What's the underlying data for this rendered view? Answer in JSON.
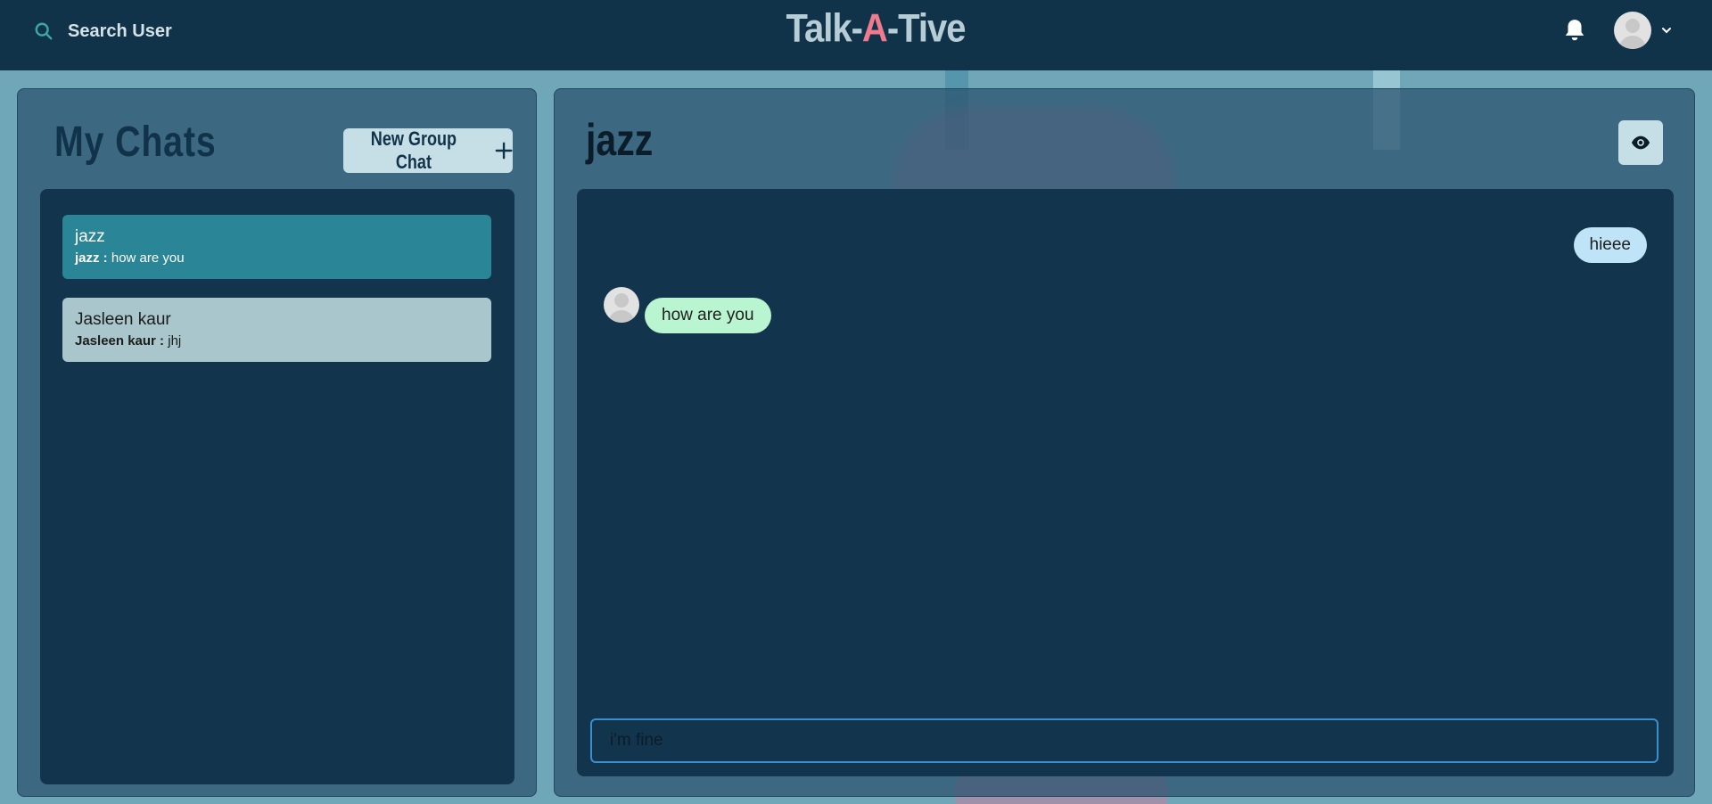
{
  "header": {
    "search_label": "Search User",
    "logo_prefix": "Talk-",
    "logo_accent": "A",
    "logo_suffix": "-Tive",
    "icons": {
      "search": "search-icon",
      "bell": "bell-icon",
      "avatar": "avatar-icon",
      "chevron": "chevron-down-icon"
    }
  },
  "sidebar": {
    "title": "My Chats",
    "new_group_label": "New Group Chat",
    "chats": [
      {
        "name": "jazz",
        "last_sender": "jazz :",
        "last_message": " how are you",
        "active": true
      },
      {
        "name": "Jasleen kaur",
        "last_sender": "Jasleen kaur :",
        "last_message": " jhj",
        "active": false
      }
    ]
  },
  "conversation": {
    "title": "jazz",
    "messages": [
      {
        "text": "hieee",
        "mine": true
      },
      {
        "text": "how are you",
        "mine": false
      }
    ],
    "input_value": "i'm fine"
  },
  "colors": {
    "header_bg": "#11334a",
    "accent": "#f07a8e",
    "active_chat": "#2a8596",
    "inactive_chat": "#a8c6cb",
    "my_bubble": "#bfe3f7",
    "their_bubble": "#b9f5d0",
    "input_border": "#3a8fd0"
  }
}
